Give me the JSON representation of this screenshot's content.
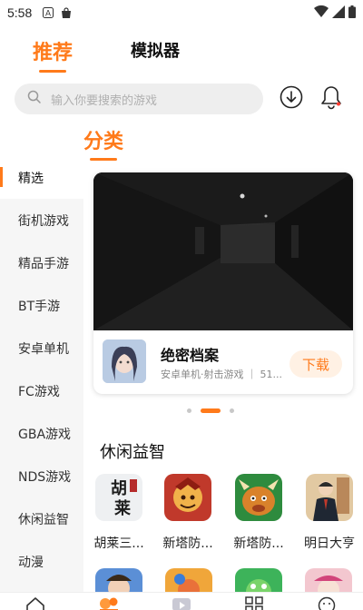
{
  "status_bar": {
    "time": "5:58"
  },
  "top_tabs": [
    {
      "label": "推荐",
      "active": true
    },
    {
      "label": "模拟器",
      "active": false
    }
  ],
  "search": {
    "placeholder": "输入你要搜索的游戏"
  },
  "section_title": "分类",
  "sidebar": {
    "items": [
      {
        "label": "精选",
        "active": true
      },
      {
        "label": "街机游戏"
      },
      {
        "label": "精品手游"
      },
      {
        "label": "BT手游"
      },
      {
        "label": "安卓单机"
      },
      {
        "label": "FC游戏"
      },
      {
        "label": "GBA游戏"
      },
      {
        "label": "NDS游戏"
      },
      {
        "label": "休闲益智"
      },
      {
        "label": "动漫"
      }
    ]
  },
  "banner": {
    "title": "绝密档案",
    "meta": "安卓单机·射击游戏 ｜ 51...",
    "download_label": "下载"
  },
  "carousel": {
    "count": 3,
    "active_index": 1
  },
  "category_heading": "休闲益智",
  "games": [
    {
      "label": "胡莱三...",
      "icon_text": "胡莱"
    },
    {
      "label": "新塔防..."
    },
    {
      "label": "新塔防..."
    },
    {
      "label": "明日大亨"
    }
  ],
  "colors": {
    "accent": "#ff7a1a",
    "sidebar_bg": "#f6f6f6",
    "search_bg": "#eeeeee"
  },
  "bottom_nav_icons": [
    "home-icon",
    "community-icon",
    "video-icon",
    "apps-icon",
    "profile-icon"
  ]
}
